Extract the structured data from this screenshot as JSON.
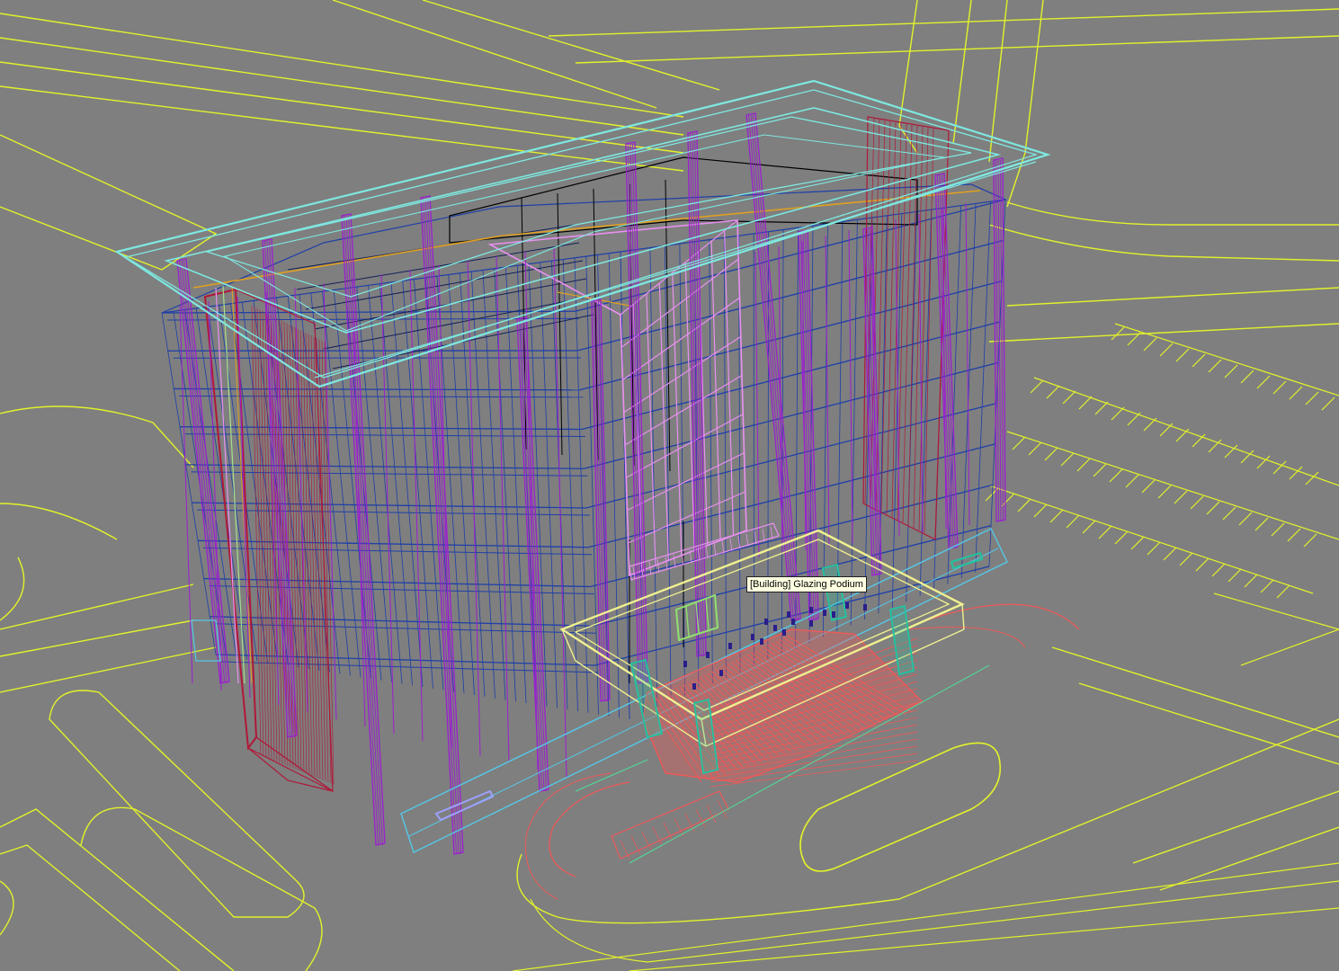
{
  "viewport": {
    "mode": "wireframe",
    "background": "#7f7f7f"
  },
  "tooltip": {
    "label": "[Building] Glazing Podium"
  },
  "colors": {
    "site_lines": "#e2f22a",
    "curtain_wall": "#1e3fa8",
    "mullions": "#9b1fd0",
    "roof_parapet": "#7ee8e0",
    "core": "#000000",
    "facade_glazing": "#e890f0",
    "stair_tower": "#b01838",
    "entrance_canopy": "#f0f090",
    "entrance_stairs": "#f05858",
    "canopy_columns": "#21c4a0",
    "slab_edges": "#e0a020",
    "planters": "#55c8e8"
  }
}
